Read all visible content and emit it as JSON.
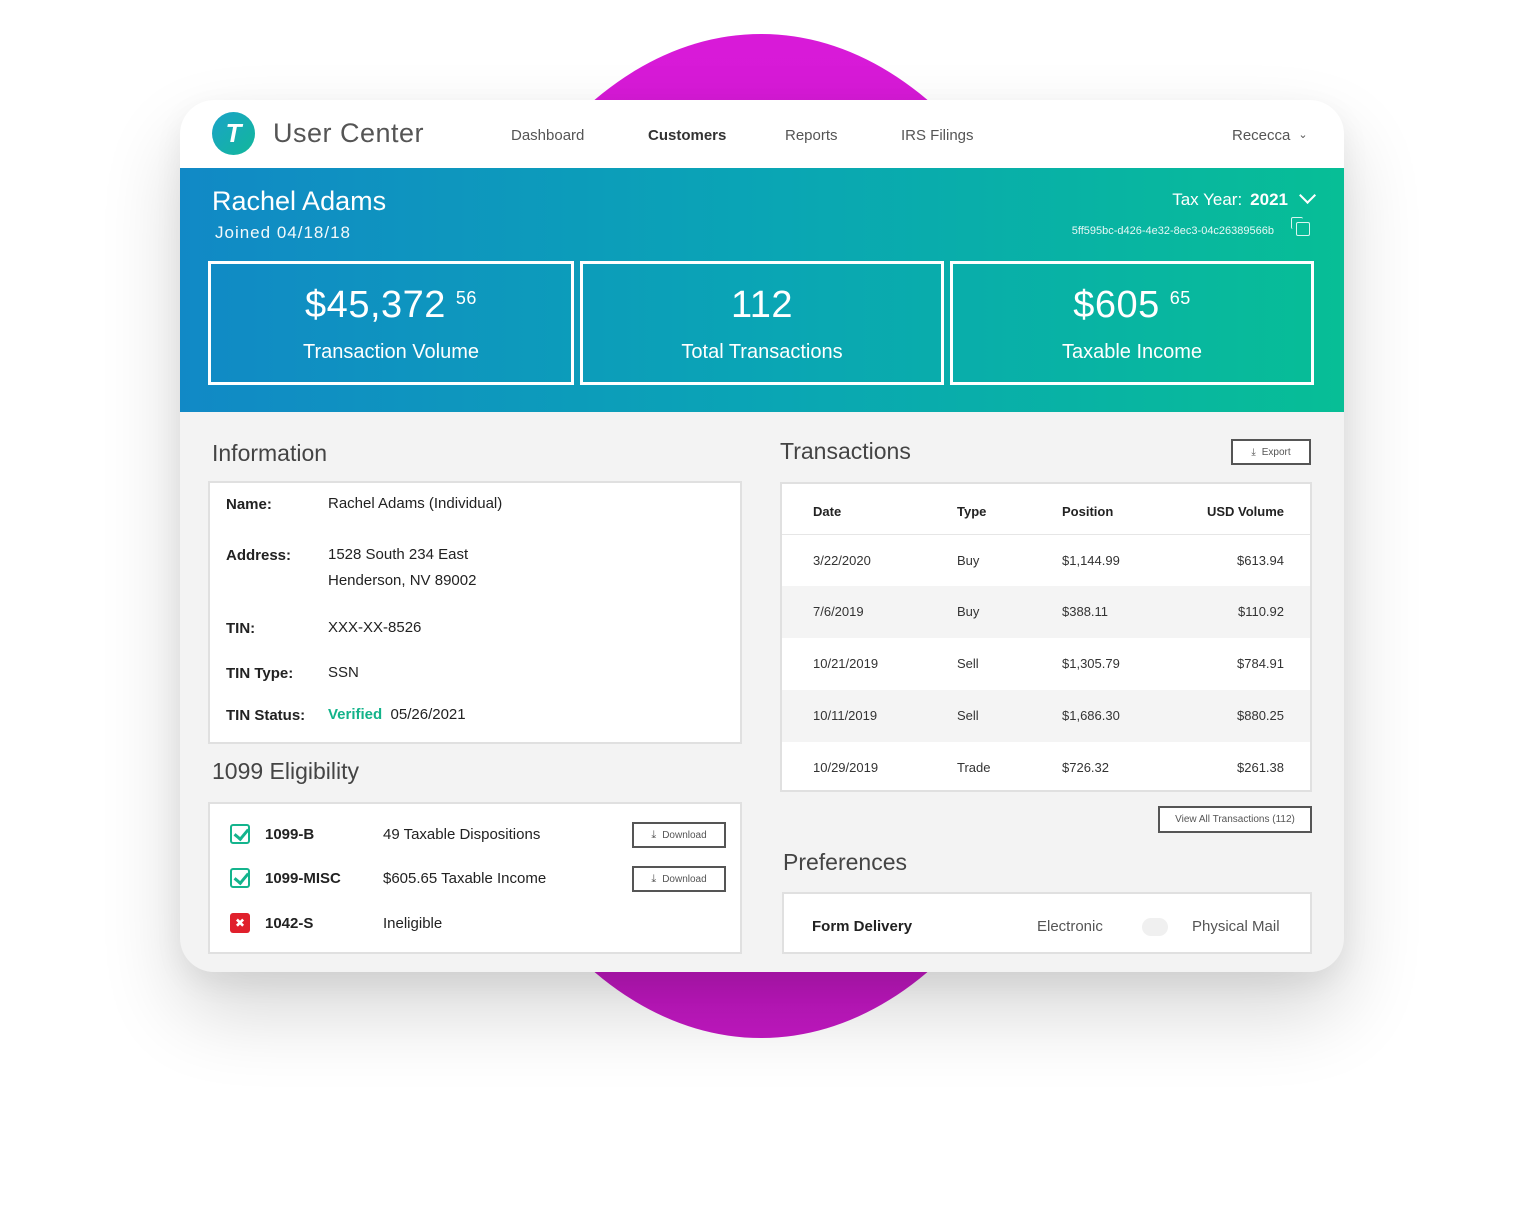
{
  "app": {
    "logo_letter": "T",
    "title": "User Center"
  },
  "nav": [
    {
      "label": "Dashboard",
      "active": false
    },
    {
      "label": "Customers",
      "active": true
    },
    {
      "label": "Reports",
      "active": false
    },
    {
      "label": "IRS Filings",
      "active": false
    }
  ],
  "user_menu": {
    "name": "Rececca"
  },
  "customer": {
    "name": "Rachel Adams",
    "joined": "Joined 04/18/18",
    "tax_year_label": "Tax Year:",
    "tax_year": "2021",
    "id": "5ff595bc-d426-4e32-8ec3-04c26389566b"
  },
  "stats": [
    {
      "value": "$45,372",
      "cents": "56",
      "label": "Transaction Volume"
    },
    {
      "value": "112",
      "cents": "",
      "label": "Total Transactions"
    },
    {
      "value": "$605",
      "cents": "65",
      "label": "Taxable Income"
    }
  ],
  "information": {
    "title": "Information",
    "name_label": "Name:",
    "name_value": "Rachel Adams (Individual)",
    "address_label": "Address:",
    "address_line1": "1528 South  234 East",
    "address_line2": "Henderson, NV 89002",
    "tin_label": "TIN:",
    "tin_value": "XXX-XX-8526",
    "tin_type_label": "TIN Type:",
    "tin_type_value": "SSN",
    "tin_status_label": "TIN Status:",
    "tin_status_value": "Verified",
    "tin_status_date": "05/26/2021"
  },
  "eligibility": {
    "title": "1099 Eligibility",
    "items": [
      {
        "form": "1099-B",
        "description": "49 Taxable Dispositions",
        "status": "eligible",
        "button": "Download"
      },
      {
        "form": "1099-MISC",
        "description": "$605.65 Taxable Income",
        "status": "eligible",
        "button": "Download"
      },
      {
        "form": "1042-S",
        "description": "Ineligible",
        "status": "ineligible",
        "button": ""
      }
    ]
  },
  "transactions": {
    "title": "Transactions",
    "export_label": "Export",
    "headers": [
      "Date",
      "Type",
      "Position",
      "USD Volume"
    ],
    "rows": [
      {
        "date": "3/22/2020",
        "type": "Buy",
        "position": "$1,144.99",
        "usd": "$613.94"
      },
      {
        "date": "7/6/2019",
        "type": "Buy",
        "position": "$388.11",
        "usd": "$110.92"
      },
      {
        "date": "10/21/2019",
        "type": "Sell",
        "position": "$1,305.79",
        "usd": "$784.91"
      },
      {
        "date": "10/11/2019",
        "type": "Sell",
        "position": "$1,686.30",
        "usd": "$880.25"
      },
      {
        "date": "10/29/2019",
        "type": "Trade",
        "position": "$726.32",
        "usd": "$261.38"
      }
    ],
    "view_all_label": "View All Transactions  (112)"
  },
  "preferences": {
    "title": "Preferences",
    "form_delivery_label": "Form Delivery",
    "option_left": "Electronic",
    "option_right": "Physical Mail"
  },
  "colors": {
    "accent_teal": "#07be96",
    "accent_blue": "#1189c6",
    "backdrop_magenta": "#d81ad8",
    "verified_green": "#13b38a",
    "ineligible_red": "#e0202c"
  }
}
